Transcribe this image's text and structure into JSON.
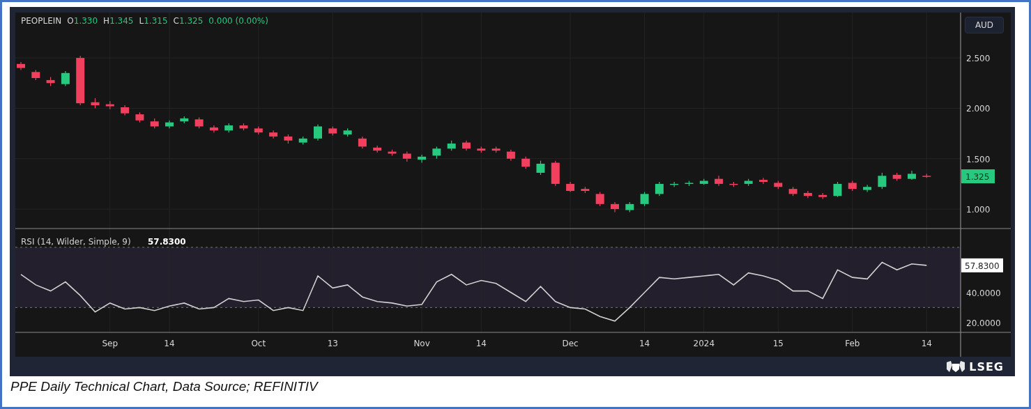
{
  "legend": {
    "symbol": "PEOPLEIN",
    "items": [
      {
        "label": "O",
        "value": "1.330"
      },
      {
        "label": "H",
        "value": "1.345"
      },
      {
        "label": "L",
        "value": "1.315"
      },
      {
        "label": "C",
        "value": "1.325"
      }
    ],
    "change": "0.000 (0.00%)"
  },
  "currency_button": "AUD",
  "price_chart": {
    "last_price_tag": "1.325",
    "chart_data": {
      "type": "candlestick",
      "ylim": [
        0.8,
        2.95
      ],
      "grid": true,
      "yticks": [
        {
          "value": 1,
          "label": "1.000"
        },
        {
          "value": 1.5,
          "label": "1.500"
        },
        {
          "value": 2,
          "label": "2.000"
        },
        {
          "value": 2.5,
          "label": "2.500"
        }
      ],
      "categories": [
        null,
        null,
        null,
        null,
        null,
        null,
        null,
        null,
        null,
        null,
        null,
        null,
        null,
        null,
        null,
        null,
        null,
        null,
        null,
        null,
        null,
        null,
        null,
        null,
        null,
        null,
        null,
        null,
        null,
        null,
        null,
        null,
        null,
        null,
        null,
        null,
        null,
        null,
        null,
        null,
        null,
        null,
        null,
        null,
        null,
        null,
        null,
        null,
        null,
        null,
        null,
        null,
        null,
        null,
        null,
        null,
        null,
        null,
        null,
        null,
        null,
        null
      ],
      "ohlc": [
        [
          2.44,
          2.46,
          2.38,
          2.4
        ],
        [
          2.36,
          2.38,
          2.28,
          2.3
        ],
        [
          2.28,
          2.31,
          2.22,
          2.25
        ],
        [
          2.24,
          2.37,
          2.22,
          2.35
        ],
        [
          2.5,
          2.52,
          2.03,
          2.05
        ],
        [
          2.06,
          2.1,
          2.0,
          2.03
        ],
        [
          2.04,
          2.07,
          1.99,
          2.02
        ],
        [
          2.01,
          2.03,
          1.93,
          1.95
        ],
        [
          1.94,
          1.96,
          1.86,
          1.88
        ],
        [
          1.87,
          1.9,
          1.8,
          1.82
        ],
        [
          1.82,
          1.88,
          1.8,
          1.86
        ],
        [
          1.87,
          1.92,
          1.85,
          1.9
        ],
        [
          1.89,
          1.91,
          1.8,
          1.82
        ],
        [
          1.81,
          1.83,
          1.76,
          1.78
        ],
        [
          1.78,
          1.85,
          1.76,
          1.83
        ],
        [
          1.83,
          1.85,
          1.78,
          1.8
        ],
        [
          1.8,
          1.82,
          1.74,
          1.76
        ],
        [
          1.76,
          1.78,
          1.7,
          1.72
        ],
        [
          1.72,
          1.74,
          1.65,
          1.68
        ],
        [
          1.66,
          1.72,
          1.64,
          1.7
        ],
        [
          1.7,
          1.84,
          1.68,
          1.82
        ],
        [
          1.8,
          1.82,
          1.73,
          1.75
        ],
        [
          1.74,
          1.8,
          1.72,
          1.78
        ],
        [
          1.7,
          1.72,
          1.6,
          1.62
        ],
        [
          1.61,
          1.63,
          1.56,
          1.58
        ],
        [
          1.57,
          1.59,
          1.53,
          1.55
        ],
        [
          1.55,
          1.57,
          1.47,
          1.5
        ],
        [
          1.49,
          1.54,
          1.46,
          1.52
        ],
        [
          1.53,
          1.62,
          1.5,
          1.6
        ],
        [
          1.6,
          1.68,
          1.58,
          1.65
        ],
        [
          1.66,
          1.68,
          1.58,
          1.6
        ],
        [
          1.6,
          1.62,
          1.56,
          1.58
        ],
        [
          1.6,
          1.62,
          1.56,
          1.58
        ],
        [
          1.57,
          1.59,
          1.48,
          1.5
        ],
        [
          1.5,
          1.52,
          1.4,
          1.42
        ],
        [
          1.36,
          1.48,
          1.34,
          1.45
        ],
        [
          1.46,
          1.48,
          1.23,
          1.25
        ],
        [
          1.25,
          1.27,
          1.17,
          1.18
        ],
        [
          1.2,
          1.22,
          1.16,
          1.18
        ],
        [
          1.15,
          1.17,
          1.03,
          1.05
        ],
        [
          1.05,
          1.07,
          0.97,
          1.0
        ],
        [
          0.99,
          1.07,
          0.97,
          1.05
        ],
        [
          1.05,
          1.17,
          1.03,
          1.15
        ],
        [
          1.15,
          1.27,
          1.13,
          1.25
        ],
        [
          1.24,
          1.27,
          1.22,
          1.25
        ],
        [
          1.25,
          1.28,
          1.23,
          1.26
        ],
        [
          1.25,
          1.3,
          1.24,
          1.28
        ],
        [
          1.3,
          1.33,
          1.23,
          1.25
        ],
        [
          1.25,
          1.27,
          1.22,
          1.24
        ],
        [
          1.25,
          1.3,
          1.23,
          1.28
        ],
        [
          1.29,
          1.31,
          1.25,
          1.27
        ],
        [
          1.26,
          1.28,
          1.2,
          1.22
        ],
        [
          1.2,
          1.22,
          1.13,
          1.15
        ],
        [
          1.16,
          1.18,
          1.11,
          1.13
        ],
        [
          1.14,
          1.16,
          1.1,
          1.12
        ],
        [
          1.13,
          1.27,
          1.12,
          1.25
        ],
        [
          1.26,
          1.28,
          1.18,
          1.2
        ],
        [
          1.19,
          1.24,
          1.17,
          1.22
        ],
        [
          1.22,
          1.36,
          1.2,
          1.33
        ],
        [
          1.34,
          1.36,
          1.28,
          1.3
        ],
        [
          1.3,
          1.38,
          1.29,
          1.35
        ],
        [
          1.33,
          1.35,
          1.31,
          1.325
        ]
      ]
    }
  },
  "rsi_chart": {
    "reading": "57.8300",
    "axis_tag": "57.8300",
    "chart_data": {
      "type": "line",
      "title": "RSI (14, Wilder, Simple, 9)",
      "ylim": [
        13.5,
        82
      ],
      "grid": true,
      "yticks": [
        {
          "value": 20,
          "label": "20.0000"
        },
        {
          "value": 40,
          "label": "40.0000"
        }
      ],
      "categories": [
        null,
        null,
        null,
        null,
        null,
        null,
        "Sep",
        null,
        null,
        null,
        "14",
        null,
        null,
        null,
        null,
        null,
        "Oct",
        null,
        null,
        null,
        null,
        "13",
        null,
        null,
        null,
        null,
        null,
        "Nov",
        null,
        null,
        null,
        "14",
        null,
        null,
        null,
        null,
        null,
        "Dec",
        null,
        null,
        null,
        null,
        "14",
        null,
        null,
        null,
        "2024",
        null,
        null,
        null,
        null,
        "15",
        null,
        null,
        null,
        null,
        "Feb",
        null,
        null,
        null,
        null,
        "14"
      ],
      "series": [
        {
          "color": "#d1d1d1",
          "values": [
            52,
            45,
            41,
            47,
            38,
            27,
            33,
            29,
            30,
            28,
            31,
            33,
            29,
            30,
            36,
            34,
            35,
            28,
            30,
            28,
            51,
            43,
            45,
            37,
            34,
            33,
            31,
            32,
            47,
            52,
            45,
            48,
            46,
            40,
            34,
            44,
            34,
            30,
            29,
            24,
            21,
            30,
            40,
            50,
            49,
            50,
            51,
            52,
            45,
            53,
            51,
            48,
            41,
            41,
            36,
            55,
            50,
            49,
            60,
            55,
            59,
            58
          ]
        }
      ],
      "ref_lines": [
        {
          "axis": "y",
          "value": 70
        },
        {
          "axis": "y",
          "value": 30
        }
      ]
    }
  },
  "footer": {
    "logo_text": "LSEG"
  },
  "caption": "PPE Daily Technical Chart, Data Source; REFINITIV"
}
